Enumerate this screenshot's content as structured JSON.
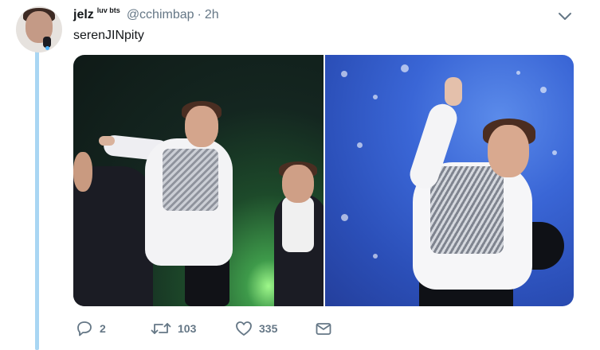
{
  "tweet": {
    "author": {
      "display_name": "jelz",
      "display_name_suffix": "luv bts",
      "handle": "@cchimbap",
      "avatar_icon": "avatar-photo"
    },
    "separator": "·",
    "timestamp": "2h",
    "text": "serenJINpity",
    "media": [
      {
        "id": "photo-1"
      },
      {
        "id": "photo-2"
      }
    ],
    "actions": {
      "reply": {
        "icon": "reply-icon",
        "count": "2"
      },
      "retweet": {
        "icon": "retweet-icon",
        "count": "103"
      },
      "like": {
        "icon": "heart-icon",
        "count": "335"
      },
      "dm": {
        "icon": "envelope-icon"
      }
    },
    "menu_icon": "chevron-down-icon"
  },
  "colors": {
    "text_primary": "#14171a",
    "text_secondary": "#657786",
    "thread_line": "#a9d6f3"
  }
}
